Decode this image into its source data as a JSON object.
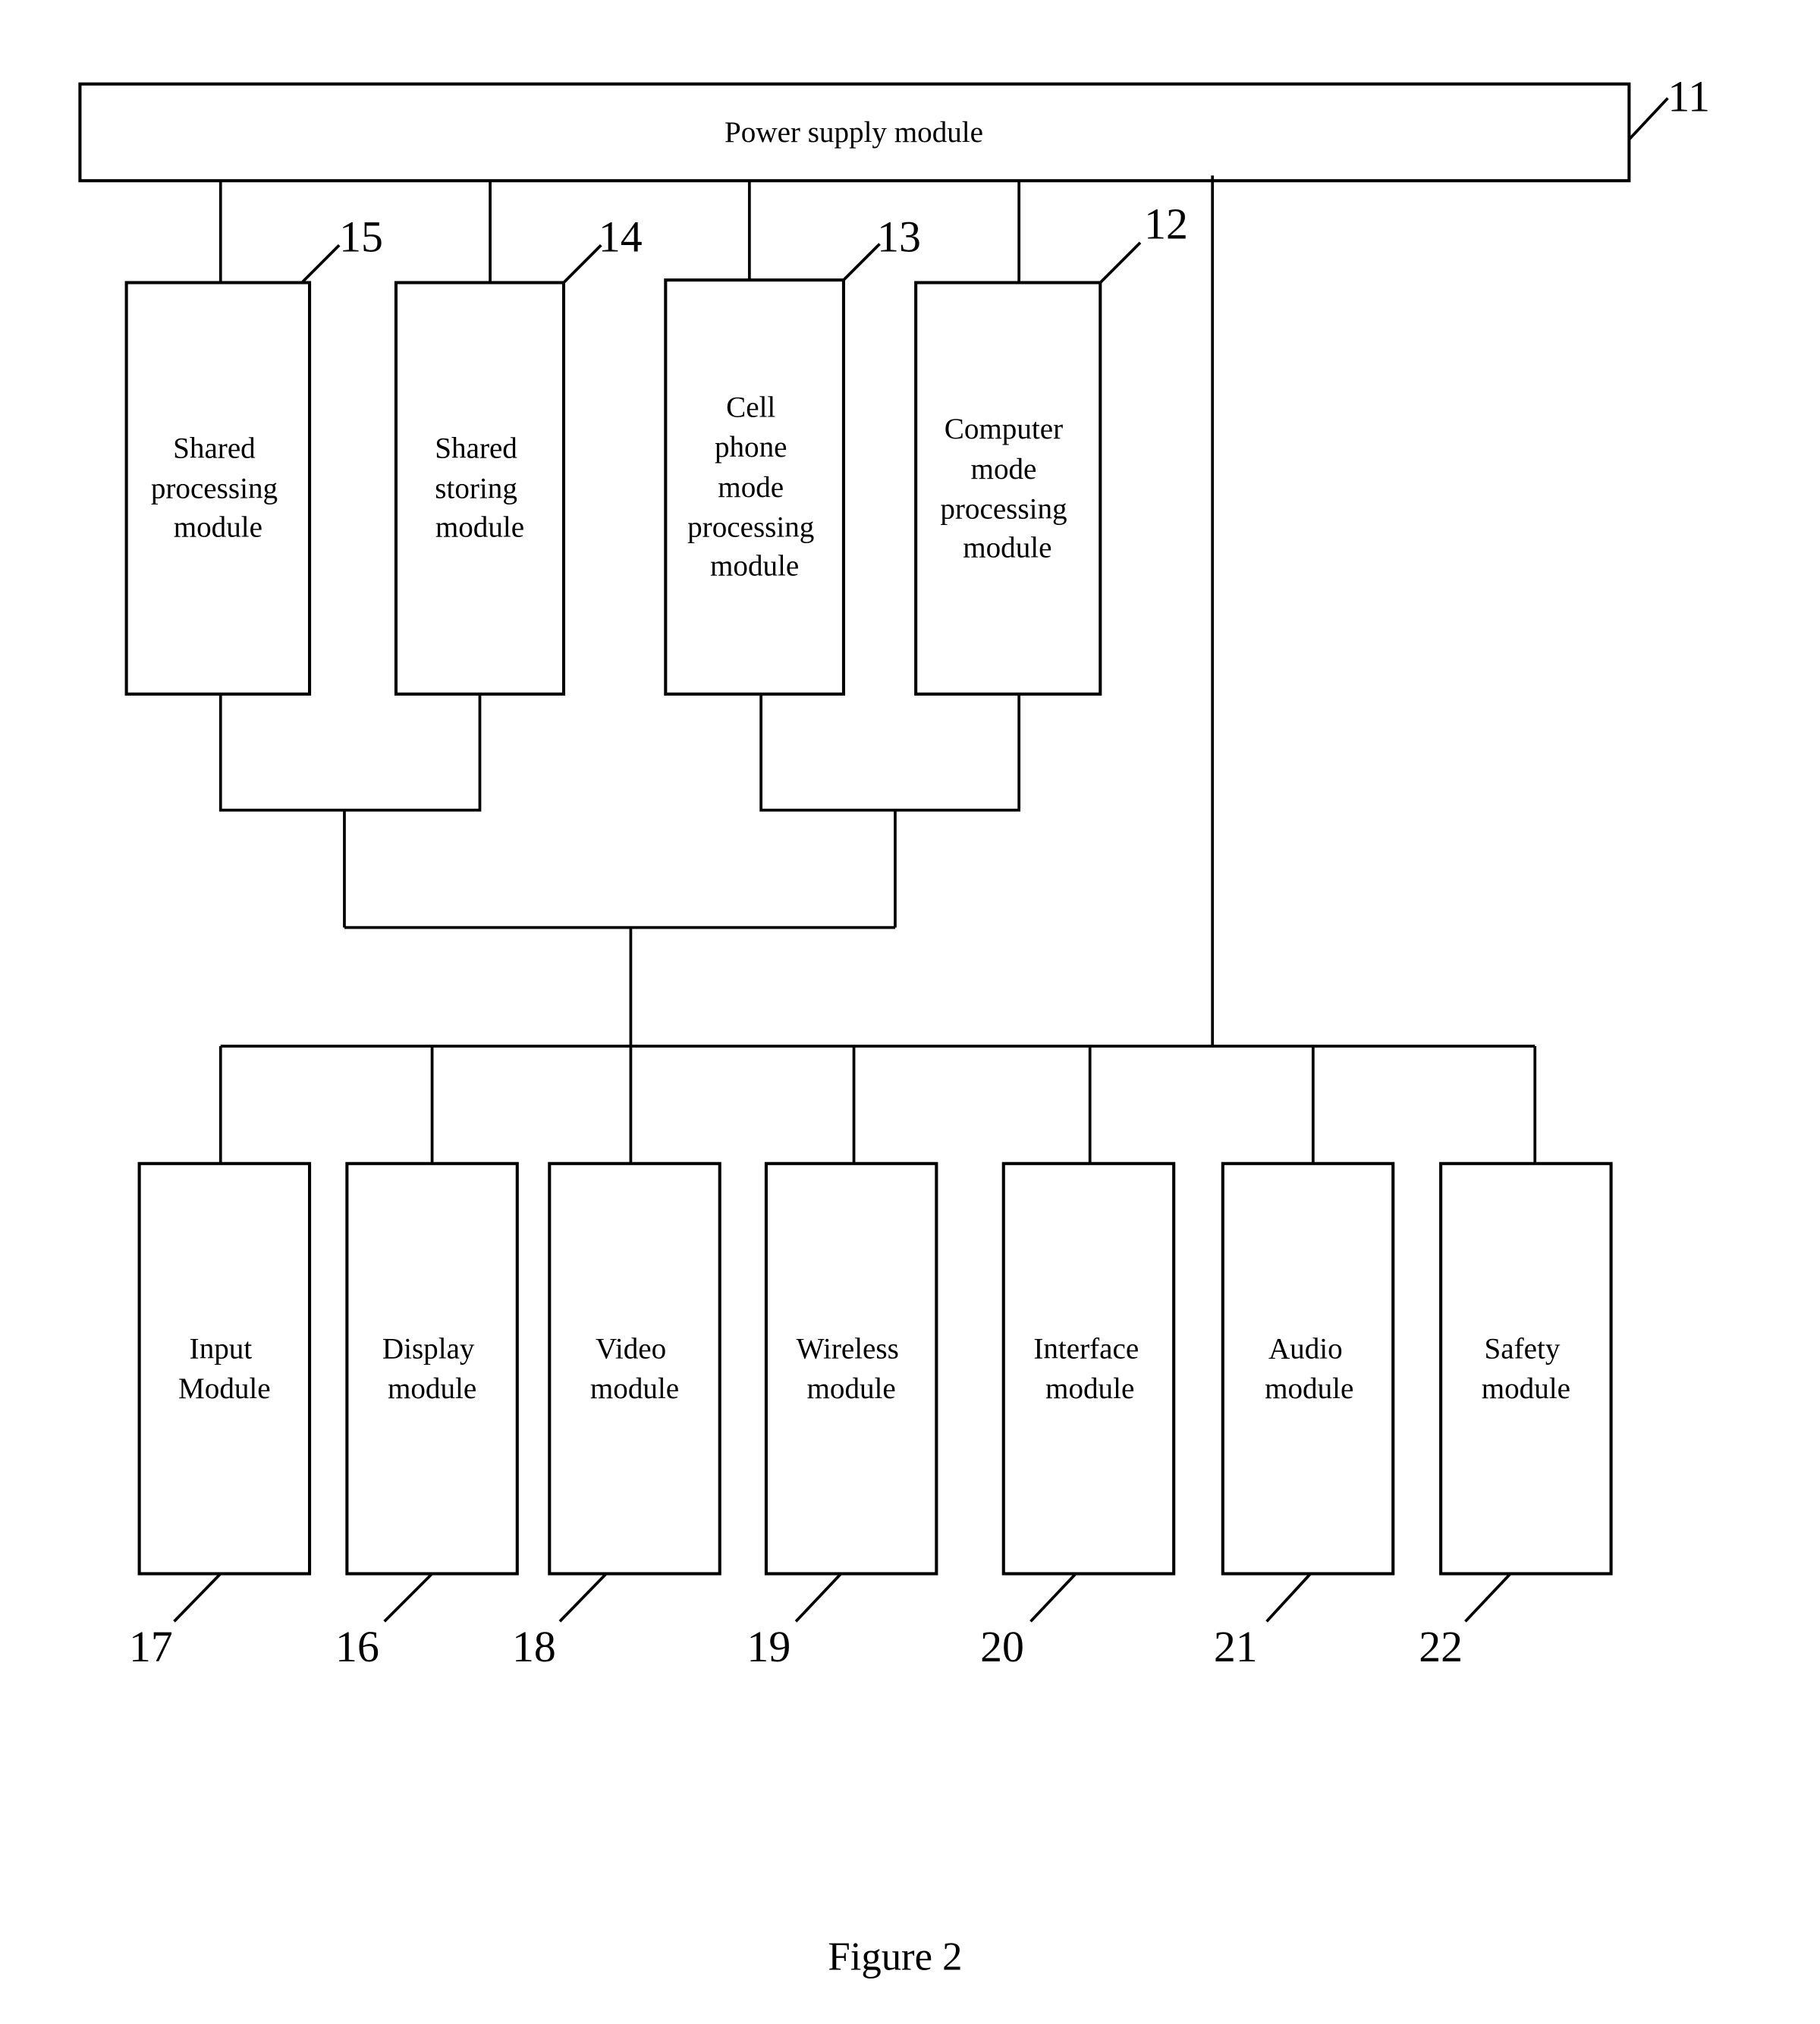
{
  "figure": {
    "caption": "Figure 2",
    "power": {
      "ref": "11",
      "label": "Power supply module"
    },
    "upper_modules": [
      {
        "id": "shared-processing",
        "ref": "15",
        "lines": [
          "Shared",
          "processing",
          "module"
        ]
      },
      {
        "id": "shared-storing",
        "ref": "14",
        "lines": [
          "Shared",
          "storing",
          "module"
        ]
      },
      {
        "id": "cell-phone-mode-processing",
        "ref": "13",
        "lines": [
          "Cell",
          "phone",
          "mode",
          "processing",
          "module"
        ]
      },
      {
        "id": "computer-mode-processing",
        "ref": "12",
        "lines": [
          "Computer",
          "mode",
          "processing",
          "module"
        ]
      }
    ],
    "lower_modules": [
      {
        "id": "input",
        "ref": "17",
        "lines": [
          "Input",
          "Module"
        ]
      },
      {
        "id": "display",
        "ref": "16",
        "lines": [
          "Display",
          "module"
        ]
      },
      {
        "id": "video",
        "ref": "18",
        "lines": [
          "Video",
          "module"
        ]
      },
      {
        "id": "wireless",
        "ref": "19",
        "lines": [
          "Wireless",
          "module"
        ]
      },
      {
        "id": "interface",
        "ref": "20",
        "lines": [
          "Interface",
          "module"
        ]
      },
      {
        "id": "audio",
        "ref": "21",
        "lines": [
          "Audio",
          "module"
        ]
      },
      {
        "id": "safety",
        "ref": "22",
        "lines": [
          "Safety",
          "module"
        ]
      }
    ]
  }
}
